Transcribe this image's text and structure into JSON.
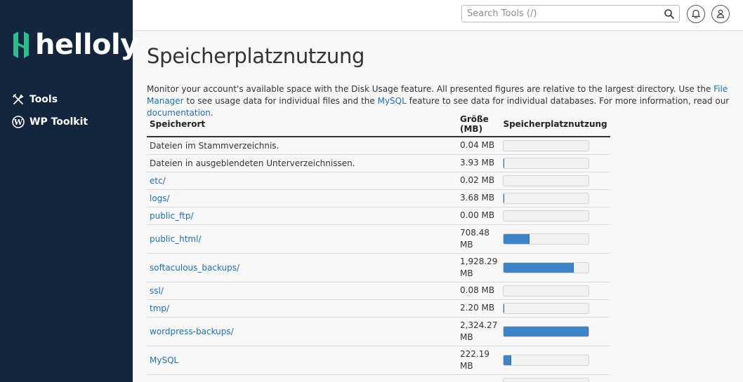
{
  "brand": {
    "name": "helloly",
    "accent": "#2bbd8c"
  },
  "sidebar": {
    "items": [
      {
        "label": "Tools",
        "icon": "tools-icon"
      },
      {
        "label": "WP Toolkit",
        "icon": "wordpress-icon"
      }
    ]
  },
  "topbar": {
    "search_placeholder": "Search Tools (/)",
    "notifications_icon": "bell-icon",
    "user_icon": "user-icon"
  },
  "page": {
    "title": "Speicherplatznutzung",
    "intro_1": "Monitor your account's available space with the Disk Usage feature. All presented figures are relative to the largest directory. Use the ",
    "intro_link_1": "File Manager",
    "intro_2": " to see usage data for individual files and the ",
    "intro_link_2": "MySQL",
    "intro_3": " feature to see data for individual databases. For more information, read our ",
    "intro_link_3": "documentation",
    "intro_4": "."
  },
  "table": {
    "headers": {
      "location": "Speicherort",
      "size": "Größe (MB)",
      "usage": "Speicherplatznutzung"
    },
    "bar_color": "#3d85c6",
    "rows": [
      {
        "location": "Dateien im Stammverzeichnis.",
        "link": false,
        "size": "0.04 MB",
        "usage": 0.0
      },
      {
        "location": "Dateien in ausgeblendeten Unterverzeichnissen.",
        "link": false,
        "size": "3.93 MB",
        "usage": 0.002
      },
      {
        "location": "etc/",
        "link": true,
        "size": "0.02 MB",
        "usage": 0.0
      },
      {
        "location": "logs/",
        "link": true,
        "size": "3.68 MB",
        "usage": 0.002
      },
      {
        "location": "public_ftp/",
        "link": true,
        "size": "0.00 MB",
        "usage": 0.0
      },
      {
        "location": "public_html/",
        "link": true,
        "size": "708.48 MB",
        "usage": 0.3
      },
      {
        "location": "softaculous_backups/",
        "link": true,
        "size": "1,928.29 MB",
        "usage": 0.82
      },
      {
        "location": "ssl/",
        "link": true,
        "size": "0.08 MB",
        "usage": 0.0
      },
      {
        "location": "tmp/",
        "link": true,
        "size": "2.20 MB",
        "usage": 0.001
      },
      {
        "location": "wordpress-backups/",
        "link": true,
        "size": "2,324.27 MB",
        "usage": 1.0
      },
      {
        "location": "MySQL",
        "link": true,
        "size": "222.19 MB",
        "usage": 0.09
      },
      {
        "location": "",
        "link": false,
        "size": "",
        "usage": 0.0
      }
    ]
  }
}
